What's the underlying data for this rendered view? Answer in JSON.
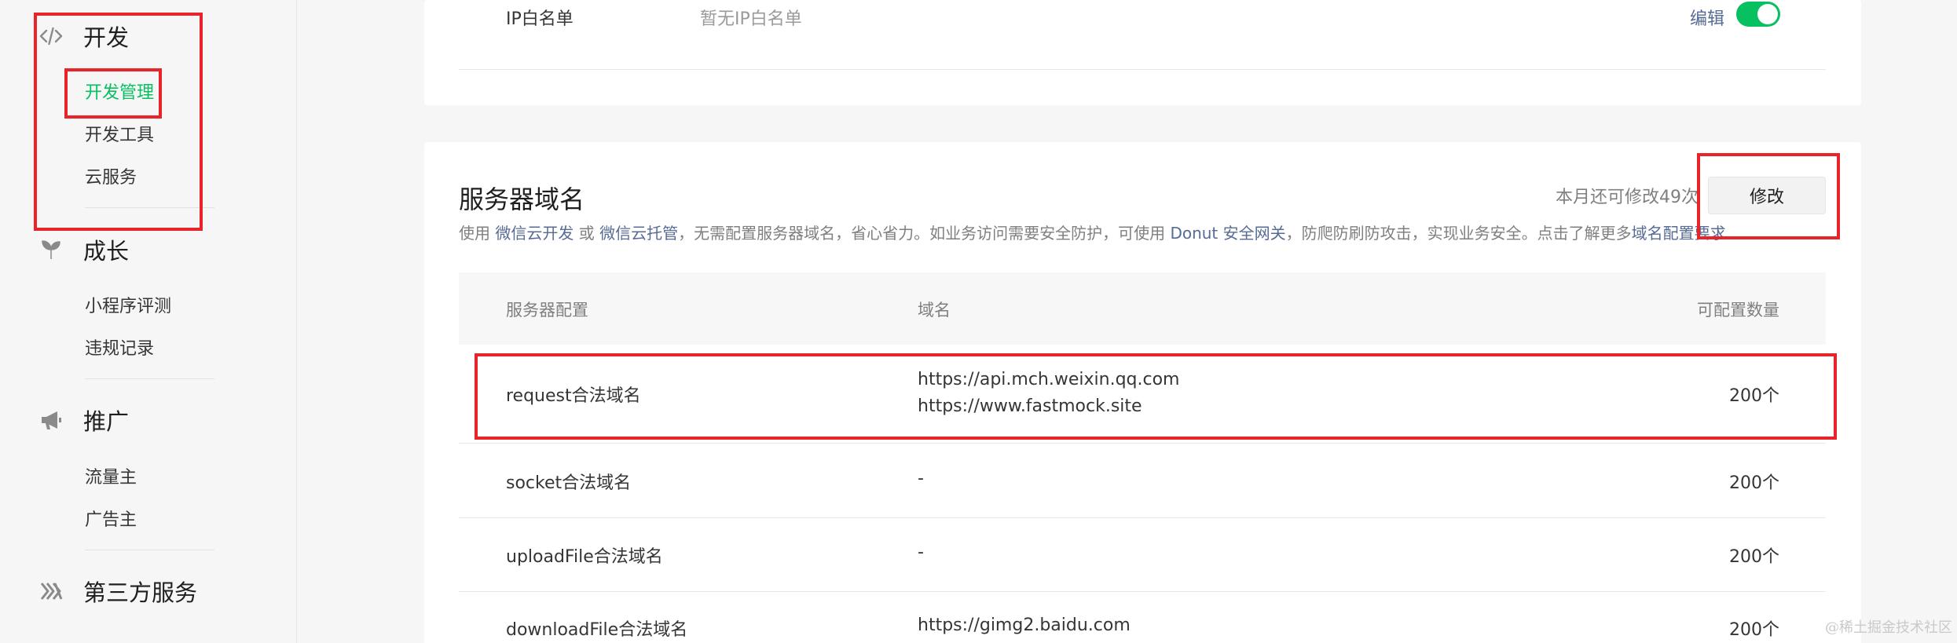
{
  "sidebar": {
    "sections": [
      {
        "title": "开发",
        "icon": "code-icon",
        "items": [
          "开发管理",
          "开发工具",
          "云服务"
        ]
      },
      {
        "title": "成长",
        "icon": "sprout-icon",
        "items": [
          "小程序评测",
          "违规记录"
        ]
      },
      {
        "title": "推广",
        "icon": "megaphone-icon",
        "items": [
          "流量主",
          "广告主"
        ]
      },
      {
        "title": "第三方服务",
        "icon": "third-party-icon",
        "items": []
      }
    ],
    "active_item": "开发管理"
  },
  "ip_whitelist": {
    "label": "IP白名单",
    "value": "暂无IP白名单",
    "edit_label": "编辑",
    "enabled": true
  },
  "server_domain": {
    "title": "服务器域名",
    "quota_text": "本月还可修改49次",
    "modify_label": "修改",
    "desc": {
      "p1": "使用 ",
      "link1": "微信云开发",
      "p2": " 或 ",
      "link2": "微信云托管",
      "p3": "，无需配置服务器域名，省心省力。如业务访问需要安全防护，可使用 ",
      "link3": "Donut 安全网关",
      "p4": "，防爬防刷防攻击，实现业务安全。点击了解更多",
      "link4": "域名配置要求"
    },
    "table": {
      "headers": [
        "服务器配置",
        "域名",
        "可配置数量"
      ],
      "rows": [
        {
          "name": "request合法域名",
          "domains": [
            "https://api.mch.weixin.qq.com",
            "https://www.fastmock.site"
          ],
          "count": "200个"
        },
        {
          "name": "socket合法域名",
          "domains": [
            "-"
          ],
          "count": "200个"
        },
        {
          "name": "uploadFile合法域名",
          "domains": [
            "-"
          ],
          "count": "200个"
        },
        {
          "name": "downloadFile合法域名",
          "domains": [
            "https://gimg2.baidu.com"
          ],
          "count": "200个"
        }
      ]
    }
  },
  "watermark": "@稀土掘金技术社区",
  "colors": {
    "accent": "#07c160",
    "link": "#576b95",
    "annotation": "#e8242b"
  }
}
